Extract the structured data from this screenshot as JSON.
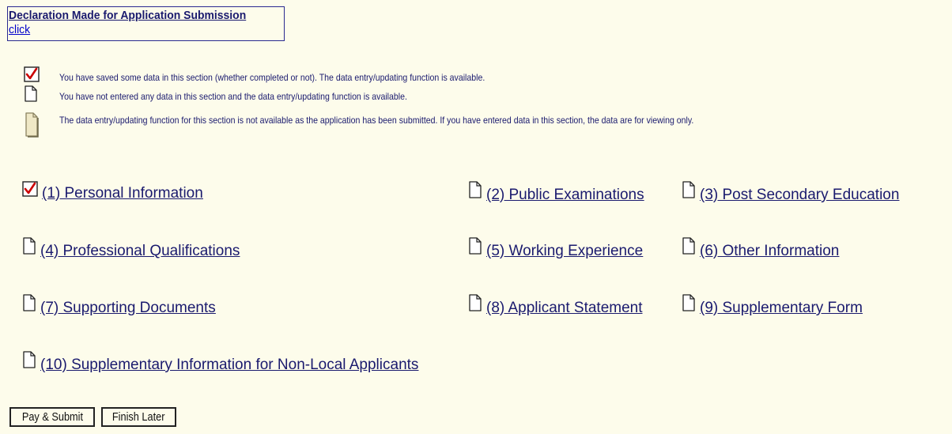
{
  "declaration": {
    "title": "Declaration Made for Application Submission",
    "link": "click"
  },
  "legend": [
    {
      "icon": "saved-check-icon",
      "text": "You have saved some data in this section (whether completed or not). The data entry/updating function is available."
    },
    {
      "icon": "blank-page-icon",
      "text": "You have not entered any data in this section and the data entry/updating function is available."
    },
    {
      "icon": "locked-page-icon",
      "text": "The data entry/updating function for this section is not available as the application has been submitted. If you have entered data in this section, the data are for viewing only."
    }
  ],
  "sections": [
    {
      "label": "(1) Personal Information",
      "status": "saved"
    },
    {
      "label": "(2) Public Examinations",
      "status": "empty"
    },
    {
      "label": "(3) Post Secondary Education",
      "status": "empty"
    },
    {
      "label": "(4) Professional Qualifications",
      "status": "empty"
    },
    {
      "label": "(5) Working Experience",
      "status": "empty"
    },
    {
      "label": "(6) Other Information",
      "status": "empty"
    },
    {
      "label": "(7) Supporting Documents",
      "status": "empty"
    },
    {
      "label": "(8) Applicant Statement",
      "status": "empty"
    },
    {
      "label": "(9) Supplementary Form",
      "status": "empty"
    },
    {
      "label": "(10) Supplementary Information for Non-Local Applicants",
      "status": "empty"
    }
  ],
  "buttons": {
    "pay_submit": "Pay & Submit",
    "finish_later": "Finish Later"
  },
  "colors": {
    "background": "#FDFCEB",
    "text": "#1a1a6e",
    "check": "#cc0000"
  }
}
